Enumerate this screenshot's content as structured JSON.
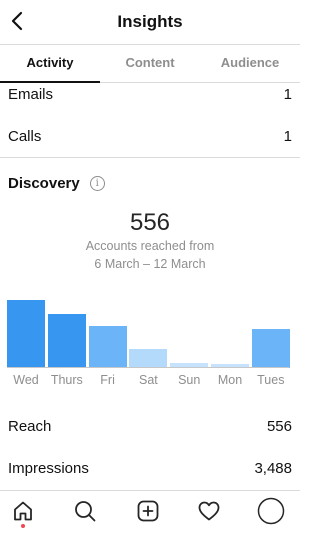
{
  "header": {
    "title": "Insights",
    "back_icon": "chevron-left-icon"
  },
  "tabs": [
    {
      "label": "Activity",
      "active": true
    },
    {
      "label": "Content",
      "active": false
    },
    {
      "label": "Audience",
      "active": false
    }
  ],
  "interactions": {
    "emails": {
      "label": "Emails",
      "value": "1"
    },
    "calls": {
      "label": "Calls",
      "value": "1"
    }
  },
  "discovery": {
    "title": "Discovery",
    "info_icon": "info-icon",
    "accounts_reached": "556",
    "accounts_label": "Accounts reached from",
    "date_range": "6 March – 12 March"
  },
  "chart_data": {
    "type": "bar",
    "title": "",
    "xlabel": "",
    "ylabel": "",
    "categories": [
      "Wed",
      "Thurs",
      "Fri",
      "Sat",
      "Sun",
      "Mon",
      "Tues"
    ],
    "values": [
      68,
      54,
      42,
      19,
      5,
      4,
      39
    ],
    "ylim": [
      0,
      76
    ],
    "colors": [
      "#3797f0",
      "#3797f0",
      "#6ab4f7",
      "#b3d9fb",
      "#c6e2fc",
      "#c6e2fc",
      "#6ab4f7"
    ],
    "grid": false
  },
  "metrics": {
    "reach": {
      "label": "Reach",
      "value": "556"
    },
    "impressions": {
      "label": "Impressions",
      "value": "3,488"
    }
  },
  "bottom_nav": [
    {
      "name": "home-icon"
    },
    {
      "name": "search-icon"
    },
    {
      "name": "new-post-icon"
    },
    {
      "name": "heart-icon"
    },
    {
      "name": "profile-icon"
    }
  ],
  "colors": {
    "accent": "#3797f0",
    "notification": "#ed4956",
    "divider": "#dbdbdb",
    "muted": "#8e8e8e"
  }
}
